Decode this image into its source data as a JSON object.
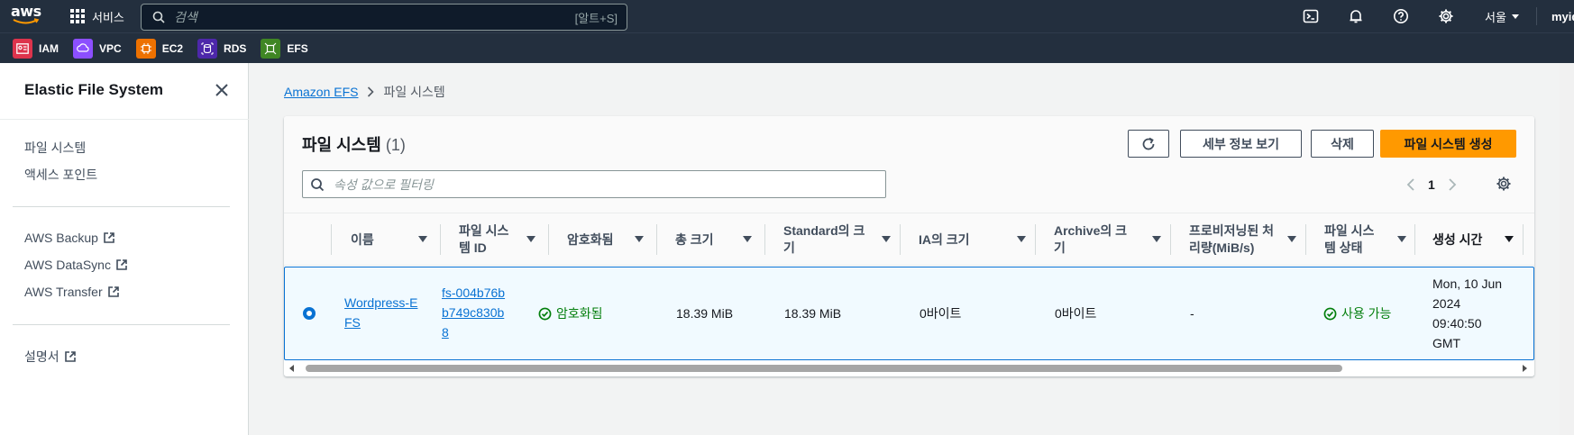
{
  "topnav": {
    "logo_text": "aws",
    "services_label": "서비스",
    "search_placeholder": "검색",
    "search_shortcut": "[알트+S]",
    "region": "서울",
    "account": "myid"
  },
  "favorites": [
    {
      "label": "IAM",
      "color": "#dd344c"
    },
    {
      "label": "VPC",
      "color": "#8c4fff"
    },
    {
      "label": "EC2",
      "color": "#ed7100"
    },
    {
      "label": "RDS",
      "color": "#4d27aa"
    },
    {
      "label": "EFS",
      "color": "#3f8624"
    }
  ],
  "sidenav": {
    "title": "Elastic File System",
    "items": [
      "파일 시스템",
      "액세스 포인트"
    ],
    "external": [
      "AWS Backup",
      "AWS DataSync",
      "AWS Transfer"
    ],
    "docs": "설명서"
  },
  "breadcrumb": {
    "root": "Amazon EFS",
    "current": "파일 시스템"
  },
  "panel": {
    "title": "파일 시스템",
    "count": "(1)",
    "buttons": {
      "details": "세부 정보 보기",
      "delete": "삭제",
      "create": "파일 시스템 생성"
    },
    "filter_placeholder": "속성 값으로 필터링",
    "page": "1"
  },
  "table": {
    "headers": [
      "이름",
      "파일 시스템 ID",
      "암호화됨",
      "총 크기",
      "Standard의 크기",
      "IA의 크기",
      "Archive의 크기",
      "프로비저닝된 처리량(MiB/s)",
      "파일 시스템 상태",
      "생성 시간"
    ],
    "row": {
      "name": "Wordpress-EFS",
      "id": "fs-004b76bb749c830b8",
      "encrypted": "암호화됨",
      "total_size": "18.39 MiB",
      "standard_size": "18.39 MiB",
      "ia_size": "0바이트",
      "archive_size": "0바이트",
      "throughput": "-",
      "state": "사용 가능",
      "created": "Mon, 10 Jun 2024 09:40:50 GMT"
    }
  }
}
